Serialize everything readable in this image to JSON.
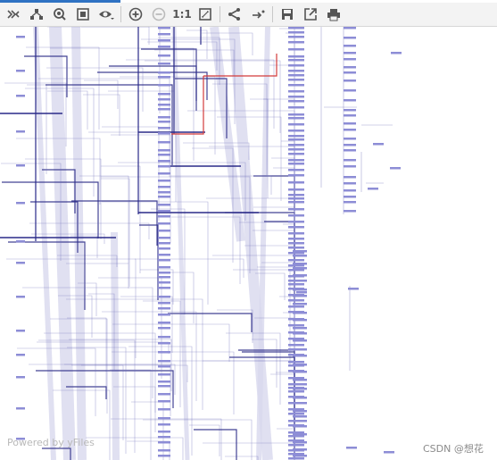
{
  "toolbar": {
    "zoom_reset_label": "1:1",
    "buttons": [
      {
        "name": "collapse-icon"
      },
      {
        "name": "layout-icon"
      },
      {
        "name": "zoom-focus-icon"
      },
      {
        "name": "fit-content-icon"
      },
      {
        "name": "eye-icon"
      },
      {
        "name": "zoom-in-icon"
      },
      {
        "name": "zoom-out-icon"
      },
      {
        "name": "zoom-reset"
      },
      {
        "name": "fit-window-icon"
      },
      {
        "name": "share-icon"
      },
      {
        "name": "arrow-right-icon"
      },
      {
        "name": "save-icon"
      },
      {
        "name": "export-icon"
      },
      {
        "name": "print-icon"
      }
    ]
  },
  "graph": {
    "edge_color": "#6b6bb8",
    "highlight_color": "#d33b3b",
    "node_color": "#8d8dd6",
    "bundle_color": "#d8d8ee"
  },
  "watermark": "Powered by yFiles",
  "csdn_label": "CSDN @想花"
}
